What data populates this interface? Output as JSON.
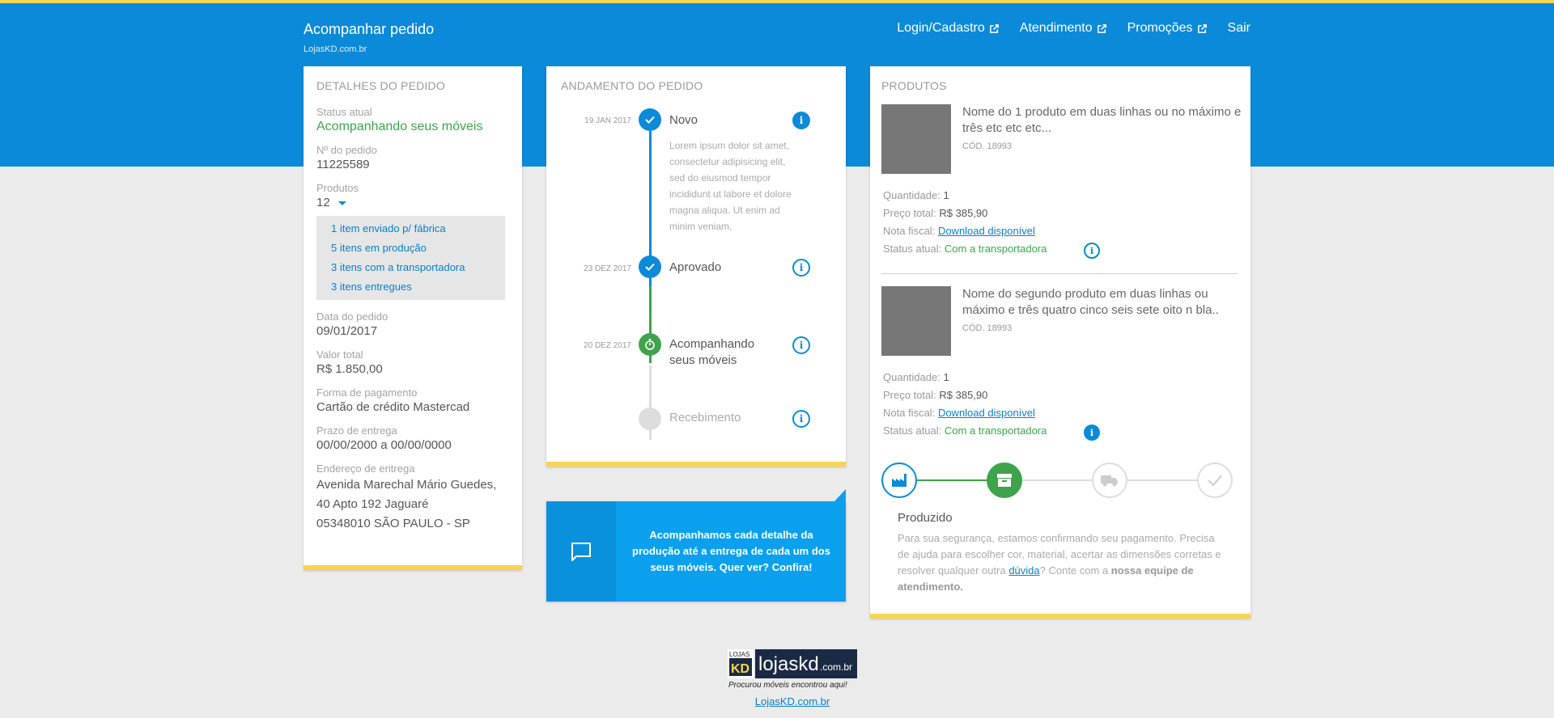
{
  "header": {
    "title": "Acompanhar pedido",
    "subtitle": "LojasKD.com.br",
    "nav": [
      "Login/Cadastro",
      "Atendimento",
      "Promoções",
      "Sair"
    ]
  },
  "details": {
    "heading": "DETALHES DO PEDIDO",
    "status_label": "Status atual",
    "status_value": "Acompanhando seus móveis",
    "order_label": "Nº do pedido",
    "order_value": "11225589",
    "products_label": "Produtos",
    "products_value": "12",
    "product_items": [
      "1 item enviado p/ fábrica",
      "5 itens em produção",
      "3 itens com a transportadora",
      "3 itens entregues"
    ],
    "date_label": "Data do pedido",
    "date_value": "09/01/2017",
    "total_label": "Valor total",
    "total_value": "R$ 1.850,00",
    "payment_label": "Forma de pagamento",
    "payment_value": "Cartão de crédito Mastercad",
    "deadline_label": "Prazo de entrega",
    "deadline_value": "00/00/2000 a 00/00/0000",
    "address_label": "Endereço de entrega",
    "address_lines": [
      "Avenida Marechal Mário Guedes,",
      "40 Apto 192 Jaguaré",
      "05348010 SÃO PAULO - SP"
    ]
  },
  "progress": {
    "heading": "ANDAMENTO DO PEDIDO",
    "steps": [
      {
        "date": "19 JAN 2017",
        "label": "Novo",
        "status": "done"
      },
      {
        "date": "23 DEZ 2017",
        "label": "Aprovado",
        "status": "done"
      },
      {
        "date": "20  DEZ 2017",
        "label": "Acompanhando seus móveis",
        "status": "current"
      },
      {
        "date": "",
        "label": "Recebimento",
        "status": "pending"
      }
    ],
    "description": "Lorem ipsum dolor sit amet, consectetur adipisicing elit, sed do eiusmod tempor incididunt ut labore et dolore magna aliqua. Ut enim ad minim veniam,",
    "info_glyph": "i"
  },
  "cta": {
    "text": "Acompanhamos cada detalhe da produção até a entrega de cada um dos seus móveis. Quer ver? Confira!",
    "icon": "chat-icon"
  },
  "products": {
    "heading": "PRODUTOS",
    "items": [
      {
        "name": "Nome do 1 produto em duas linhas ou no máximo e três etc etc etc...",
        "code": "CÓD. 18993",
        "qty_label": "Quantidade:",
        "qty": "1",
        "price_label": "Preço total:",
        "price": "R$ 385,90",
        "invoice_label": "Nota fiscal:",
        "invoice_link": "Download disponível",
        "status_label": "Status atual:",
        "status": "Com a transportadora"
      },
      {
        "name": "Nome do segundo produto em duas linhas ou máximo e três quatro cinco seis sete oito n bla..",
        "code": "CÓD. 18993",
        "qty_label": "Quantidade:",
        "qty": "1",
        "price_label": "Preço total:",
        "price": "R$ 385,90",
        "invoice_label": "Nota fiscal:",
        "invoice_link": "Download disponível",
        "status_label": "Status atual:",
        "status": "Com a transportadora"
      }
    ],
    "stages": [
      "factory-icon",
      "box-icon",
      "truck-icon",
      "check-icon"
    ],
    "active_stage": 1,
    "stage_title": "Produzido",
    "stage_text_1": "Para sua segurança, estamos confirmando seu pagamento. Precisa de ajuda para escolher cor, material, acertar as dimensões corretas e resolver qualquer outra ",
    "stage_link": "dúvida",
    "stage_text_2": "? Conte com a ",
    "stage_text_bold": "nossa equipe de atendimento."
  },
  "footer": {
    "logo_lojas": "LOJAS",
    "logo_kd": "KD",
    "logo_site": "lojaskd",
    "logo_tld": ".com.br",
    "logo_tagline": "Procurou móveis encontrou aqui!",
    "link": "LojasKD.com.br"
  },
  "colors": {
    "primary": "#0a8ad8",
    "accent": "#fcd34d",
    "success": "#3fa34d",
    "background": "#ebebeb"
  }
}
